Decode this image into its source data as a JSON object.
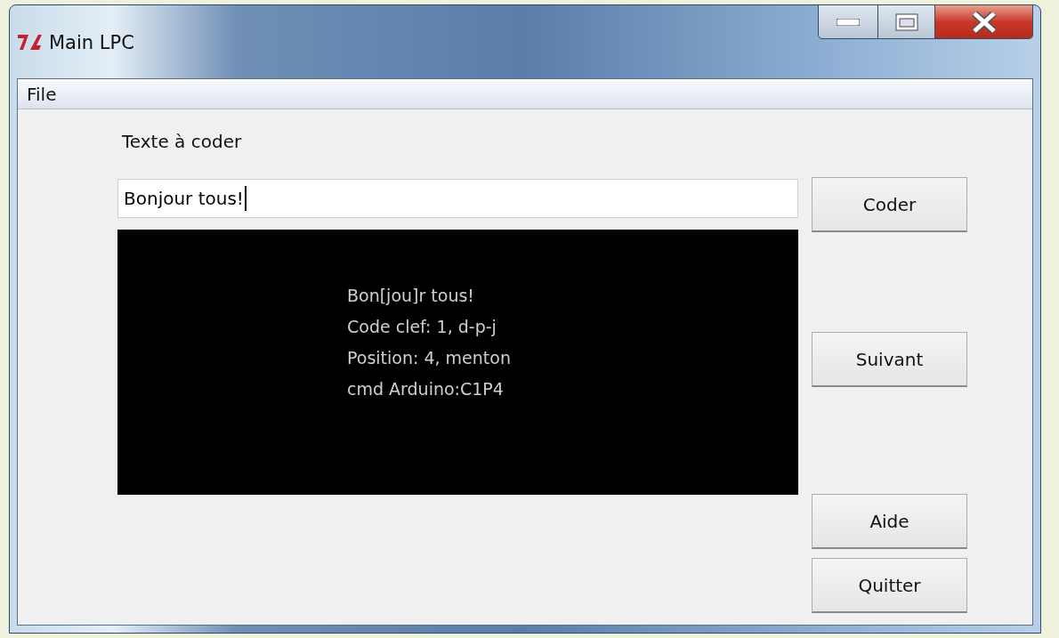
{
  "window": {
    "title": "Main LPC"
  },
  "menu": [
    {
      "label": "File"
    }
  ],
  "form": {
    "label": "Texte à coder",
    "entry": {
      "value": "Bonjour tous!"
    }
  },
  "output": {
    "lines": [
      "Bon[jou]r tous!",
      "Code clef: 1, d-p-j",
      "Position: 4, menton",
      "cmd Arduino:C1P4"
    ]
  },
  "buttons": [
    {
      "label": "Coder"
    },
    {
      "label": "Suivant"
    },
    {
      "label": "Aide"
    },
    {
      "label": "Quitter"
    }
  ]
}
